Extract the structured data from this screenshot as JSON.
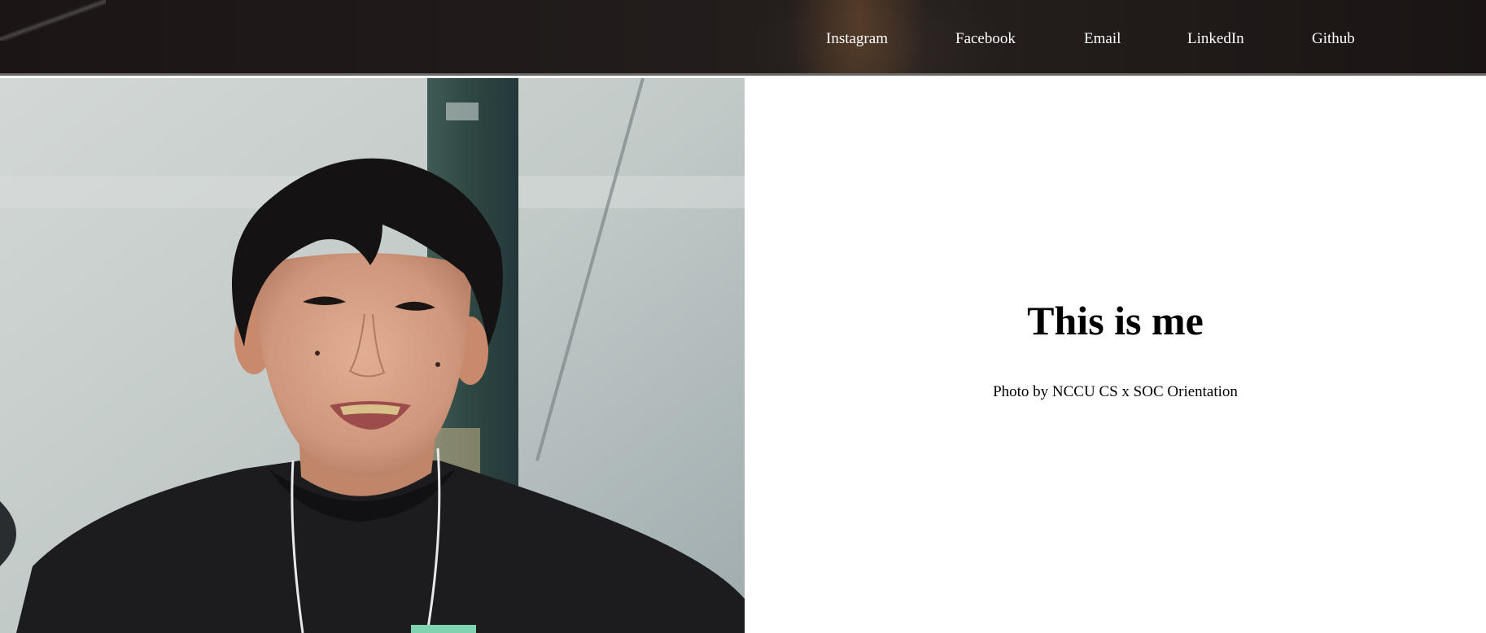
{
  "nav": {
    "items": [
      {
        "label": "Instagram"
      },
      {
        "label": "Facebook"
      },
      {
        "label": "Email"
      },
      {
        "label": "LinkedIn"
      },
      {
        "label": "Github"
      }
    ]
  },
  "main": {
    "title": "This is me",
    "credit": "Photo by NCCU CS x SOC Orientation"
  },
  "colors": {
    "header_bg": "#1f1a19",
    "nav_text": "#ffffff",
    "content_bg": "#ffffff"
  }
}
